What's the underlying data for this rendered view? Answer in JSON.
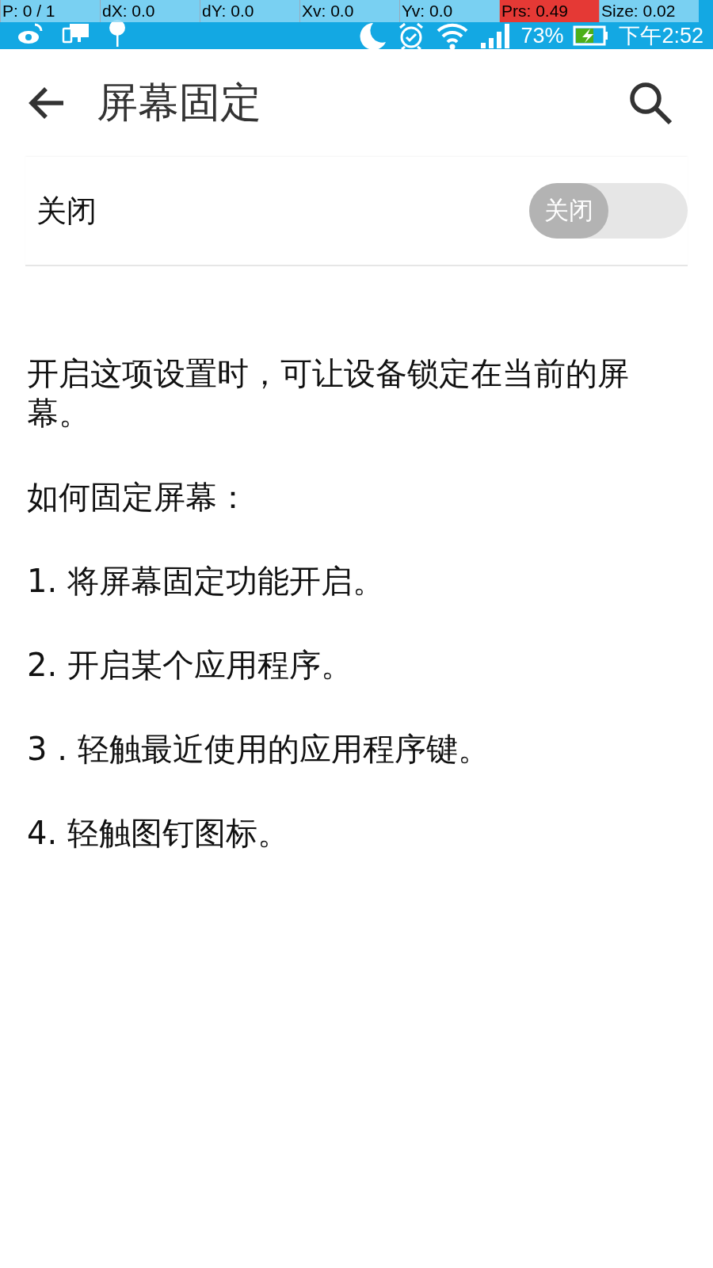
{
  "pointer_overlay": [
    {
      "text": "P: 0 / 1",
      "highlight": false
    },
    {
      "text": "dX: 0.0",
      "highlight": false
    },
    {
      "text": "dY: 0.0",
      "highlight": false
    },
    {
      "text": "Xv: 0.0",
      "highlight": false
    },
    {
      "text": "Yv: 0.0",
      "highlight": false
    },
    {
      "text": "Prs: 0.49",
      "highlight": true
    },
    {
      "text": "Size: 0.02",
      "highlight": false
    }
  ],
  "status_bar": {
    "battery": "73%",
    "time": "下午2:52"
  },
  "header": {
    "title": "屏幕固定"
  },
  "setting": {
    "label": "关闭",
    "on": false,
    "switch_text": "关闭"
  },
  "description": "开启这项设置时，可让设备锁定在当前的屏幕。",
  "instructions": [
    "如何固定屏幕：",
    "1. 将屏幕固定功能开启。",
    "2. 开启某个应用程序。",
    "3 . 轻触最近使用的应用程序键。",
    "4. 轻触图钉图标。"
  ]
}
